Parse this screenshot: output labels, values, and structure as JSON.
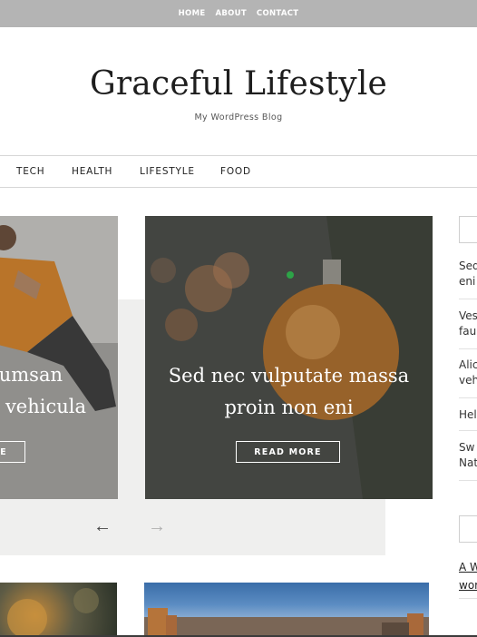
{
  "top_nav": [
    "HOME",
    "ABOUT",
    "CONTACT"
  ],
  "site": {
    "title": "Graceful Lifestyle",
    "tagline": "My WordPress Blog"
  },
  "categories": [
    "TECH",
    "HEALTH",
    "LIFESTYLE",
    "FOOD"
  ],
  "slider": {
    "slides": [
      {
        "title_line1": "umsan",
        "title_line2": "vehicula",
        "button": "E"
      },
      {
        "title_line1": "Sed nec vulputate massa",
        "title_line2": "proin non eni",
        "button": "READ MORE"
      }
    ],
    "prev_arrow": "←",
    "next_arrow": "→"
  },
  "sidebar": {
    "recent_posts": [
      {
        "line1": "Sed",
        "line2": "eni"
      },
      {
        "line1": "Ves",
        "line2": "fau"
      },
      {
        "line1": "Alic",
        "line2": "veh"
      },
      {
        "line1": "Hel",
        "line2": ""
      },
      {
        "line1": "Sw",
        "line2": "Nat"
      }
    ],
    "comments": [
      {
        "line1": "A W",
        "line2": "wor"
      }
    ]
  },
  "colors": {
    "topbar": "#b4b4b4",
    "slider_bg": "#efefee",
    "text": "#222222"
  }
}
